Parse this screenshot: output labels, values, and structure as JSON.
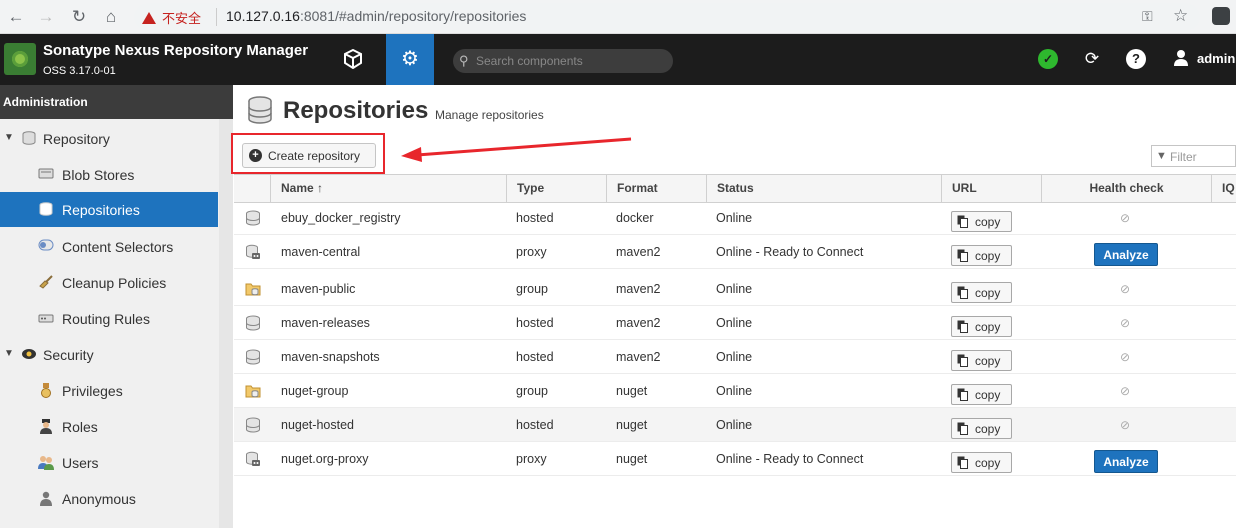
{
  "browser": {
    "security_label": "不安全",
    "url_host": "10.127.0.16",
    "url_rest": ":8081/#admin/repository/repositories"
  },
  "app": {
    "title": "Sonatype Nexus Repository Manager",
    "version": "OSS 3.17.0-01",
    "search_placeholder": "Search components",
    "user": "admin"
  },
  "sidebar": {
    "header": "Administration",
    "items": [
      {
        "label": "Repository",
        "icon": "database-icon",
        "level": 0
      },
      {
        "label": "Blob Stores",
        "icon": "drive-icon",
        "level": 1
      },
      {
        "label": "Repositories",
        "icon": "database-icon",
        "level": 1,
        "active": true
      },
      {
        "label": "Content Selectors",
        "icon": "selector-icon",
        "level": 1
      },
      {
        "label": "Cleanup Policies",
        "icon": "broom-icon",
        "level": 1
      },
      {
        "label": "Routing Rules",
        "icon": "router-icon",
        "level": 1
      },
      {
        "label": "Security",
        "icon": "security-icon",
        "level": 0
      },
      {
        "label": "Privileges",
        "icon": "medal-icon",
        "level": 1
      },
      {
        "label": "Roles",
        "icon": "role-icon",
        "level": 1
      },
      {
        "label": "Users",
        "icon": "users-icon",
        "level": 1
      },
      {
        "label": "Anonymous",
        "icon": "anonymous-icon",
        "level": 1
      }
    ]
  },
  "main": {
    "title": "Repositories",
    "subtitle": "Manage repositories",
    "create_label": "Create repository",
    "filter_placeholder": "Filter",
    "columns": [
      "Name ↑",
      "Type",
      "Format",
      "Status",
      "URL",
      "Health check",
      "IQ"
    ],
    "copy_label": "copy",
    "analyze_label": "Analyze",
    "rows": [
      {
        "name": "ebuy_docker_registry",
        "type": "hosted",
        "format": "docker",
        "status": "Online",
        "kind": "hosted",
        "health": "none"
      },
      {
        "name": "maven-central",
        "type": "proxy",
        "format": "maven2",
        "status": "Online - Ready to Connect",
        "kind": "proxy",
        "health": "analyze"
      },
      {
        "name": "maven-public",
        "type": "group",
        "format": "maven2",
        "status": "Online",
        "kind": "group",
        "health": "none"
      },
      {
        "name": "maven-releases",
        "type": "hosted",
        "format": "maven2",
        "status": "Online",
        "kind": "hosted",
        "health": "none"
      },
      {
        "name": "maven-snapshots",
        "type": "hosted",
        "format": "maven2",
        "status": "Online",
        "kind": "hosted",
        "health": "none"
      },
      {
        "name": "nuget-group",
        "type": "group",
        "format": "nuget",
        "status": "Online",
        "kind": "group",
        "health": "none"
      },
      {
        "name": "nuget-hosted",
        "type": "hosted",
        "format": "nuget",
        "status": "Online",
        "kind": "hosted",
        "health": "none"
      },
      {
        "name": "nuget.org-proxy",
        "type": "proxy",
        "format": "nuget",
        "status": "Online - Ready to Connect",
        "kind": "proxy",
        "health": "analyze"
      }
    ]
  },
  "colors": {
    "accent": "#1e73be",
    "highlight": "#e8262c",
    "ok": "#2eb82e"
  }
}
